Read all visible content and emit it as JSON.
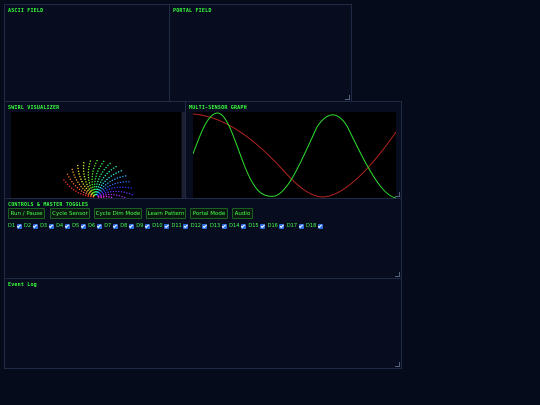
{
  "panels": {
    "ascii": {
      "title": "ASCII FIELD"
    },
    "portal": {
      "title": "PORTAL FIELD"
    },
    "swirl": {
      "title": "SWIRL VISUALIZER"
    },
    "graph": {
      "title": "MULTI-SENSOR GRAPH"
    },
    "controls": {
      "title": "CONTROLS & MASTER TOGGLES"
    },
    "log": {
      "title": "Event Log"
    }
  },
  "buttons": [
    {
      "label": "Run / Pause"
    },
    {
      "label": "Cycle Sensor"
    },
    {
      "label": "Cycle Dim Mode"
    },
    {
      "label": "Learn Pattern"
    },
    {
      "label": "Portal Mode"
    },
    {
      "label": "Audio"
    }
  ],
  "toggles": [
    {
      "label": "D1",
      "checked": true
    },
    {
      "label": "D2",
      "checked": true
    },
    {
      "label": "D3",
      "checked": true
    },
    {
      "label": "D4",
      "checked": true
    },
    {
      "label": "D5",
      "checked": true
    },
    {
      "label": "D6",
      "checked": true
    },
    {
      "label": "D7",
      "checked": true
    },
    {
      "label": "D8",
      "checked": true
    },
    {
      "label": "D9",
      "checked": true
    },
    {
      "label": "D10",
      "checked": true
    },
    {
      "label": "D11",
      "checked": true
    },
    {
      "label": "D12",
      "checked": true
    },
    {
      "label": "D13",
      "checked": true
    },
    {
      "label": "D14",
      "checked": true
    },
    {
      "label": "D15",
      "checked": true
    },
    {
      "label": "D16",
      "checked": true
    },
    {
      "label": "D17",
      "checked": true
    },
    {
      "label": "D18",
      "checked": true
    }
  ],
  "colors": {
    "accent": "#39ff3d",
    "background": "#060b1c",
    "series_green": "#2ee02e",
    "series_red": "#b0241f"
  }
}
